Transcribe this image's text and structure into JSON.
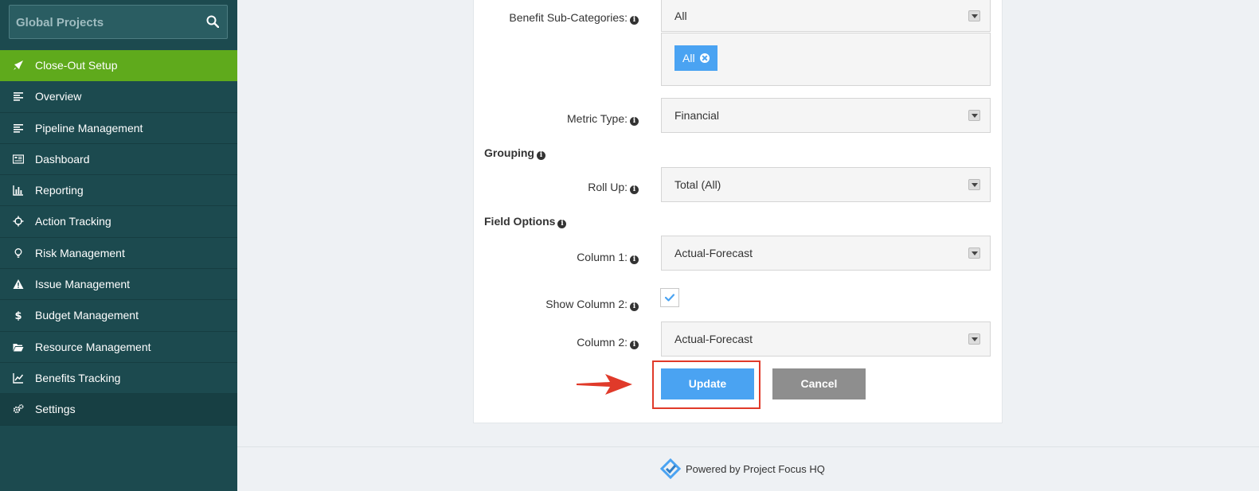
{
  "sidebar": {
    "project_title": "Global Projects",
    "items": [
      {
        "label": "Close-Out Setup",
        "icon": "rocket-icon"
      },
      {
        "label": "Overview",
        "icon": "align-left-icon"
      },
      {
        "label": "Pipeline Management",
        "icon": "align-left-icon"
      },
      {
        "label": "Dashboard",
        "icon": "dashboard-icon"
      },
      {
        "label": "Reporting",
        "icon": "bar-chart-icon"
      },
      {
        "label": "Action Tracking",
        "icon": "crosshair-icon"
      },
      {
        "label": "Risk Management",
        "icon": "lightbulb-icon"
      },
      {
        "label": "Issue Management",
        "icon": "warning-icon"
      },
      {
        "label": "Budget Management",
        "icon": "dollar-icon"
      },
      {
        "label": "Resource Management",
        "icon": "folder-open-icon"
      },
      {
        "label": "Benefits Tracking",
        "icon": "line-chart-icon"
      },
      {
        "label": "Settings",
        "icon": "gears-icon"
      }
    ]
  },
  "form": {
    "benefit_subcategories": {
      "label": "Benefit Sub-Categories:",
      "value": "All",
      "tag": "All"
    },
    "metric_type": {
      "label": "Metric Type:",
      "value": "Financial"
    },
    "grouping_heading": "Grouping",
    "roll_up": {
      "label": "Roll Up:",
      "value": "Total (All)"
    },
    "field_options_heading": "Field Options",
    "column1": {
      "label": "Column 1:",
      "value": "Actual-Forecast"
    },
    "show_column2": {
      "label": "Show Column 2:",
      "checked": true
    },
    "column2": {
      "label": "Column 2:",
      "value": "Actual-Forecast"
    },
    "update_label": "Update",
    "cancel_label": "Cancel"
  },
  "footer": {
    "text": "Powered by Project Focus HQ"
  },
  "colors": {
    "sidebar_bg": "#1c4a4f",
    "active_item": "#5faa1c",
    "primary_button": "#4aa3f2",
    "cancel_button": "#8e8e8e",
    "highlight": "#e03a2a"
  }
}
